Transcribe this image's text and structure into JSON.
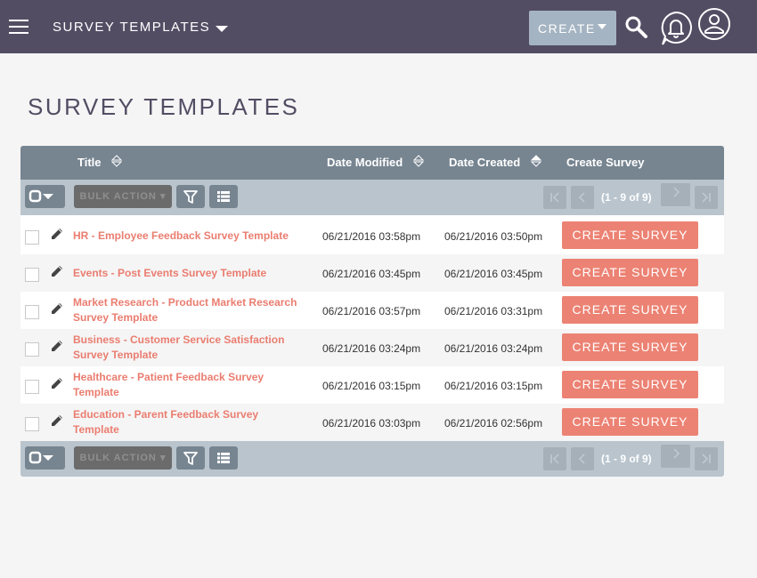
{
  "navbar": {
    "module_title": "SURVEY TEMPLATES",
    "create_label": "CREATE",
    "icons": [
      "menu-icon",
      "search-icon",
      "notification-bell-icon",
      "user-profile-icon"
    ],
    "background": "#534d64"
  },
  "page": {
    "title": "SURVEY TEMPLATES"
  },
  "table": {
    "columns": {
      "title": "Title",
      "date_modified": "Date Modified",
      "date_created": "Date Created",
      "create_survey": "Create Survey"
    },
    "bulk_action_label": "BULK ACTION",
    "pagination_text": "(1 - 9 of 9)",
    "action_label": "CREATE SURVEY",
    "rows": [
      {
        "title": "HR - Employee Feedback Survey Template",
        "date_modified": "06/21/2016 03:58pm",
        "date_created": "06/21/2016 03:50pm"
      },
      {
        "title": "Events - Post Events Survey Template",
        "date_modified": "06/21/2016 03:45pm",
        "date_created": "06/21/2016 03:45pm"
      },
      {
        "title": "Market Research - Product Market Research Survey Template",
        "date_modified": "06/21/2016 03:57pm",
        "date_created": "06/21/2016 03:31pm"
      },
      {
        "title": "Business - Customer Service Satisfaction Survey Template",
        "date_modified": "06/21/2016 03:24pm",
        "date_created": "06/21/2016 03:24pm"
      },
      {
        "title": "Healthcare - Patient Feedback Survey Template",
        "date_modified": "06/21/2016 03:15pm",
        "date_created": "06/21/2016 03:15pm"
      },
      {
        "title": "Education - Parent Feedback Survey Template",
        "date_modified": "06/21/2016 03:03pm",
        "date_created": "06/21/2016 02:56pm"
      }
    ]
  },
  "colors": {
    "accent": "#ec8273",
    "link": "#ea7d70",
    "header": "#778591",
    "pagebar": "#b9c4cd"
  }
}
